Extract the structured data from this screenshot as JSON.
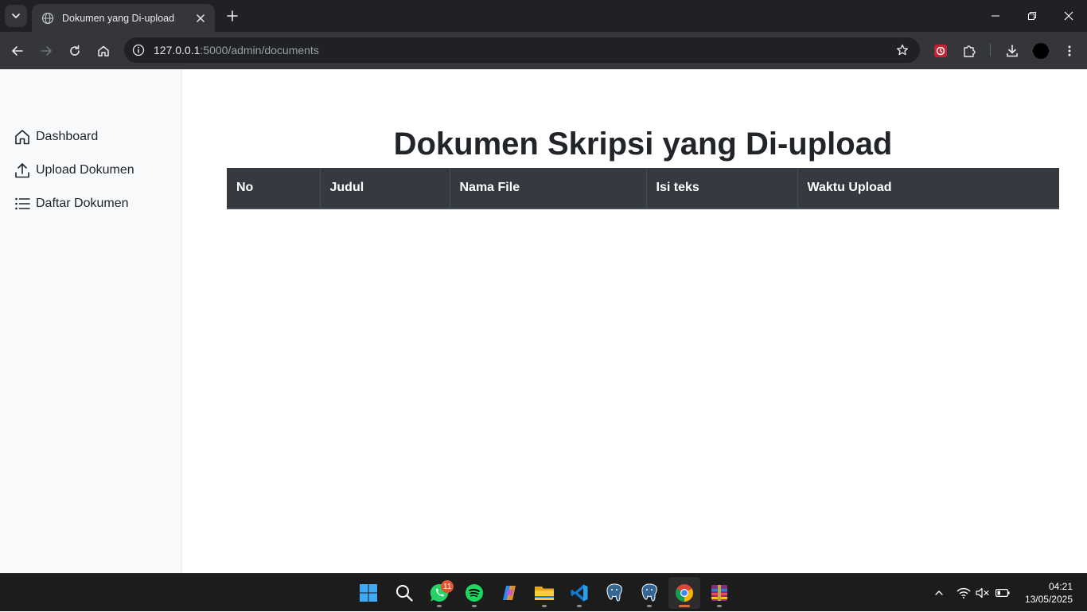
{
  "browser": {
    "tab_title": "Dokumen yang Di-upload",
    "url_host": "127.0.0.1",
    "url_path": ":5000/admin/documents"
  },
  "sidebar": {
    "items": [
      {
        "label": "Dashboard",
        "icon": "home-icon"
      },
      {
        "label": "Upload Dokumen",
        "icon": "upload-icon"
      },
      {
        "label": "Daftar Dokumen",
        "icon": "list-icon"
      }
    ]
  },
  "main": {
    "title": "Dokumen Skripsi yang Di-upload",
    "table": {
      "columns": [
        "No",
        "Judul",
        "Nama File",
        "Isi teks",
        "Waktu Upload"
      ],
      "rows": []
    }
  },
  "taskbar": {
    "apps": [
      "start-icon",
      "search-icon",
      "whatsapp-icon",
      "spotify-icon",
      "copilot-icon",
      "file-explorer-icon",
      "vscode-icon",
      "postgresql-icon",
      "postgresql-icon",
      "chrome-icon",
      "winrar-icon"
    ],
    "whatsapp_badge": "11",
    "time": "04:21",
    "date": "13/05/2025"
  },
  "colors": {
    "table_header_bg": "#343a40",
    "sidebar_bg": "#f8f9fa",
    "chrome_dark": "#202124",
    "chrome_toolbar": "#35363a"
  }
}
